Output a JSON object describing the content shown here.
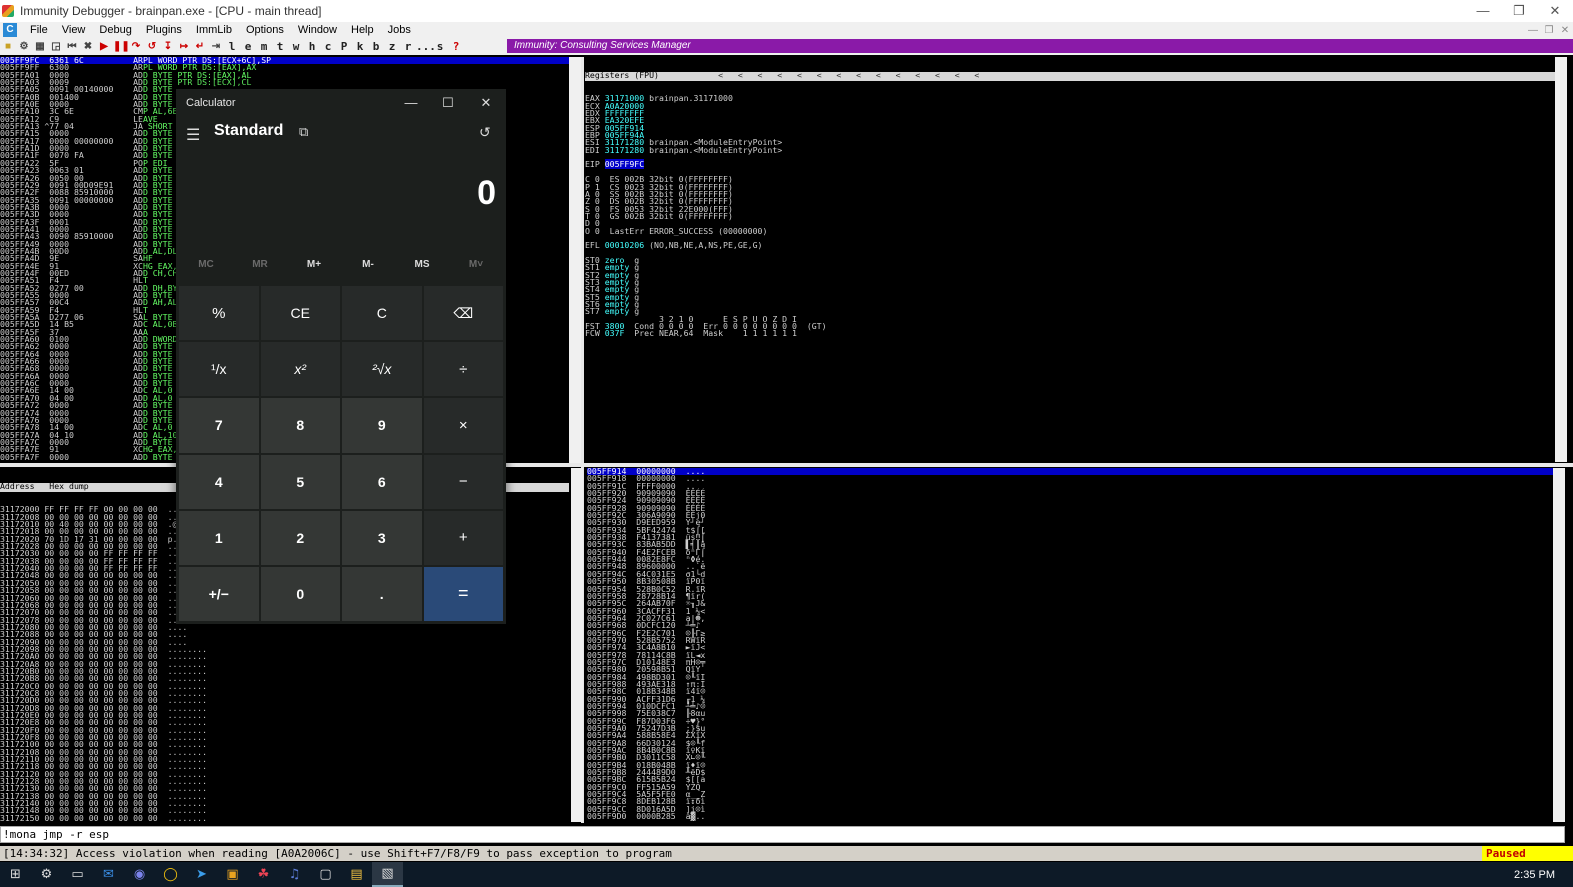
{
  "window": {
    "title": "Immunity Debugger - brainpan.exe - [CPU - main thread]"
  },
  "menu": [
    "File",
    "View",
    "Debug",
    "Plugins",
    "ImmLib",
    "Options",
    "Window",
    "Help",
    "Jobs"
  ],
  "toolbar_letters": [
    "l",
    "e",
    "m",
    "t",
    "w",
    "h",
    "c",
    "P",
    "k",
    "b",
    "z",
    "r",
    "...",
    "s",
    "?"
  ],
  "banner": "Immunity: Consulting Services Manager",
  "cpu_lines": [
    {
      "t": "005FF9FC  6361 6C          ARPL WORD PTR DS:[ECX+6C],SP",
      "sel": true
    },
    {
      "t": "005FF9FF  6300             ARPL WORD PTR DS:[EAX],AX"
    },
    {
      "t": "005FFA01  0000             ADD BYTE PTR DS:[EAX],AL"
    },
    {
      "t": "005FFA03  0009             ADD BYTE PTR DS:[ECX],CL"
    },
    {
      "t": "005FFA05  0091 00140000    ADD BYTE"
    },
    {
      "t": "005FFA0B  001400           ADD BYTE"
    },
    {
      "t": "005FFA0E  0000             ADD BYTE"
    },
    {
      "t": "005FFA10  3C 6E            CMP AL,6E"
    },
    {
      "t": "005FFA12  C9               LEAVE"
    },
    {
      "t": "005FFA13 ^77 04            JA SHORT"
    },
    {
      "t": "005FFA15  0000             ADD BYTE"
    },
    {
      "t": "005FFA17  0000 00000000    ADD BYTE"
    },
    {
      "t": "005FFA1D  0000             ADD BYTE"
    },
    {
      "t": "005FFA1F  0070 FA          ADD BYTE"
    },
    {
      "t": "005FFA22  5F               POP EDI"
    },
    {
      "t": "005FFA23  0063 01          ADD BYTE"
    },
    {
      "t": "005FFA26  0050 00          ADD BYTE"
    },
    {
      "t": "005FFA29  0091 00D09E91    ADD BYTE"
    },
    {
      "t": "005FFA2F  0088 85910000    ADD BYTE"
    },
    {
      "t": "005FFA35  0091 00000000    ADD BYTE"
    },
    {
      "t": "005FFA3B  0000             ADD BYTE"
    },
    {
      "t": "005FFA3D  0000             ADD BYTE"
    },
    {
      "t": "005FFA3F  0001             ADD BYTE"
    },
    {
      "t": "005FFA41  0000             ADD BYTE"
    },
    {
      "t": "005FFA43  0090 85910000    ADD BYTE"
    },
    {
      "t": "005FFA49  0000             ADD BYTE"
    },
    {
      "t": "005FFA4B  00D0             ADD AL,DL"
    },
    {
      "t": "005FFA4D  9E               SAHF"
    },
    {
      "t": "005FFA4E  91               XCHG EAX,ECX"
    },
    {
      "t": "005FFA4F  00ED             ADD CH,CH"
    },
    {
      "t": "005FFA51  F4               HLT"
    },
    {
      "t": "005FFA52  0277 00          ADD DH,BYTE"
    },
    {
      "t": "005FFA55  0000             ADD BYTE"
    },
    {
      "t": "005FFA57  00C4             ADD AH,AL"
    },
    {
      "t": "005FFA59  F4               HLT"
    },
    {
      "t": "005FFA5A  D277 06          SAL BYTE"
    },
    {
      "t": "005FFA5D  14 B5            ADC AL,0B5"
    },
    {
      "t": "005FFA5F  37               AAA"
    },
    {
      "t": "005FFA60  0100             ADD DWORD"
    },
    {
      "t": "005FFA62  0000             ADD BYTE"
    },
    {
      "t": "005FFA64  0000             ADD BYTE"
    },
    {
      "t": "005FFA66  0000             ADD BYTE"
    },
    {
      "t": "005FFA68  0000             ADD BYTE"
    },
    {
      "t": "005FFA6A  0000             ADD BYTE"
    },
    {
      "t": "005FFA6C  0000             ADD BYTE"
    },
    {
      "t": "005FFA6E  14 00            ADC AL,0"
    },
    {
      "t": "005FFA70  04 00            ADD AL,0"
    },
    {
      "t": "005FFA72  0000             ADD BYTE"
    },
    {
      "t": "005FFA74  0000             ADD BYTE"
    },
    {
      "t": "005FFA76  0000             ADD BYTE"
    },
    {
      "t": "005FFA78  14 00            ADC AL,0"
    },
    {
      "t": "005FFA7A  04 10            ADD AL,10"
    },
    {
      "t": "005FFA7C  0000             ADD BYTE"
    },
    {
      "t": "005FFA7E  91               XCHG EAX,"
    },
    {
      "t": "005FFA7F  0000             ADD BYTE"
    }
  ],
  "regs_header": "Registers (FPU)",
  "regs_arrows": "<   <   <   <   <   <   <   <   <   <   <   <   <   <",
  "reg_lines": [
    "EAX 31171000 brainpan.31171000",
    "ECX A0A20000",
    "EDX FFFFFFFF",
    "EBX EA320EFE",
    "ESP 005FF914",
    "EBP 005FF94A",
    "ESI 31171280 brainpan.<ModuleEntryPoint>",
    "EDI 31171280 brainpan.<ModuleEntryPoint>",
    "",
    "EIP 005FF9FC",
    "",
    "C 0  ES 002B 32bit 0(FFFFFFFF)",
    "P 1  CS 0023 32bit 0(FFFFFFFF)",
    "A 0  SS 002B 32bit 0(FFFFFFFF)",
    "Z 0  DS 002B 32bit 0(FFFFFFFF)",
    "S 0  FS 0053 32bit 22E000(FFF)",
    "T 0  GS 002B 32bit 0(FFFFFFFF)",
    "D 0",
    "O 0  LastErr ERROR_SUCCESS (00000000)",
    "",
    "EFL 00010206 (NO,NB,NE,A,NS,PE,GE,G)",
    "",
    "ST0 zero  g",
    "ST1 empty g",
    "ST2 empty g",
    "ST3 empty g",
    "ST4 empty g",
    "ST5 empty g",
    "ST6 empty g",
    "ST7 empty g",
    "               3 2 1 0      E S P U O Z D I",
    "FST 3800  Cond 0 0 0 0  Err 0 0 0 0 0 0 0 0  (GT)",
    "FCW 037F  Prec NEAR,64  Mask    1 1 1 1 1 1"
  ],
  "dump_header": "Address   Hex dump                                         AS",
  "dump_lines": [
    "31172000 FF FF FF FF 00 00 00 00  ....",
    "31172008 00 00 00 00 00 00 00 00  ....",
    "31172010 00 40 00 00 00 00 00 00  .@..",
    "31172018 00 00 00 00 00 00 00 00  ....",
    "31172020 70 1D 17 31 00 00 00 00  p..1",
    "31172028 00 00 00 00 00 00 00 00  ....",
    "31172030 00 00 00 00 FF FF FF FF  ....",
    "31172038 00 00 00 00 FF FF FF FF  ....",
    "31172040 00 00 00 00 FF FF FF FF  ....",
    "31172048 00 00 00 00 00 00 00 00  ....",
    "31172050 00 00 00 00 00 00 00 00  ....",
    "31172058 00 00 00 00 00 00 00 00  ....",
    "31172060 00 00 00 00 00 00 00 00  ....",
    "31172068 00 00 00 00 00 00 00 00  ....",
    "31172070 00 00 00 00 00 00 00 00  ....",
    "31172078 00 00 00 00 00 00 00 00  ....",
    "31172080 00 00 00 00 00 00 00 00  ....",
    "31172088 00 00 00 00 00 00 00 00  ....",
    "31172090 00 00 00 00 00 00 00 00  ....",
    "31172098 00 00 00 00 00 00 00 00  ........",
    "311720A0 00 00 00 00 00 00 00 00  ........",
    "311720A8 00 00 00 00 00 00 00 00  ........",
    "311720B0 00 00 00 00 00 00 00 00  ........",
    "311720B8 00 00 00 00 00 00 00 00  ........",
    "311720C0 00 00 00 00 00 00 00 00  ........",
    "311720C8 00 00 00 00 00 00 00 00  ........",
    "311720D0 00 00 00 00 00 00 00 00  ........",
    "311720D8 00 00 00 00 00 00 00 00  ........",
    "311720E0 00 00 00 00 00 00 00 00  ........",
    "311720E8 00 00 00 00 00 00 00 00  ........",
    "311720F0 00 00 00 00 00 00 00 00  ........",
    "311720F8 00 00 00 00 00 00 00 00  ........",
    "31172100 00 00 00 00 00 00 00 00  ........",
    "31172108 00 00 00 00 00 00 00 00  ........",
    "31172110 00 00 00 00 00 00 00 00  ........",
    "31172118 00 00 00 00 00 00 00 00  ........",
    "31172120 00 00 00 00 00 00 00 00  ........",
    "31172128 00 00 00 00 00 00 00 00  ........",
    "31172130 00 00 00 00 00 00 00 00  ........",
    "31172138 00 00 00 00 00 00 00 00  ........",
    "31172140 00 00 00 00 00 00 00 00  ........",
    "31172148 00 00 00 00 00 00 00 00  ........",
    "31172150 00 00 00 00 00 00 00 00  ........",
    "31172158 00 00 00 00 00 00 00 00  ........",
    "31172160 00 00 00 00 00 00 00 00  ........",
    "31172168 00 00 00 00 00 00 00 00  ........",
    "31172170 00 00 00 00 00 00 00 00  ........"
  ],
  "stack_lines": [
    {
      "t": "005FF914  00000000  ....",
      "sel": true
    },
    {
      "t": "005FF918  00000000  ...."
    },
    {
      "t": "005FF91C  FFFF0000  ..  "
    },
    {
      "t": "005FF920  90909090  ÉÉÉÉ"
    },
    {
      "t": "005FF924  90909090  ÉÉÉÉ"
    },
    {
      "t": "005FF928  90909090  ÉÉÉÉ"
    },
    {
      "t": "005FF92C  306A9090  ÉÉj0"
    },
    {
      "t": "005FF930  D9EED959  Y┘e┘"
    },
    {
      "t": "005FF934  5BF42474  t$⌠["
    },
    {
      "t": "005FF938  F4137381  üs‼⌠"
    },
    {
      "t": "005FF93C  83BAB5DD  ▌╡║â"
    },
    {
      "t": "005FF940  F4E2FCEB  δⁿΓ⌠"
    },
    {
      "t": "005FF944  0082E8FC  ⁿΦé."
    },
    {
      "t": "005FF948  89600000  ..`ë"
    },
    {
      "t": "005FF94C  64C031E5  σ1└d"
    },
    {
      "t": "005FF950  8B30508B  ïP0ï"
    },
    {
      "t": "005FF954  528B0C52  R.ïR"
    },
    {
      "t": "005FF958  28728B14  ¶ïr("
    },
    {
      "t": "005FF95C  264AB70F  ☼╖J&"
    },
    {
      "t": "005FF960  3CACFF31  1 ¼<"
    },
    {
      "t": "005FF964  2C027C61  a|☻,"
    },
    {
      "t": "005FF968  0DCFC120  ┴╧♪"
    },
    {
      "t": "005FF96C  F2E2C701  ☺╟Γ≥"
    },
    {
      "t": "005FF970  528B5752  RWïR"
    },
    {
      "t": "005FF974  3C4A8B10  ►ïJ<"
    },
    {
      "t": "005FF978  78114C8B  ïL◄x"
    },
    {
      "t": "005FF97C  D10148E3  πH☺╤"
    },
    {
      "t": "005FF980  20598B51  QïY "
    },
    {
      "t": "005FF984  498BD301  ☺╙ïI"
    },
    {
      "t": "005FF988  493AE318  ↑π:I"
    },
    {
      "t": "005FF98C  018B348B  ï4ï☺"
    },
    {
      "t": "005FF990  ACFF31D6  ╓1 ¼"
    },
    {
      "t": "005FF994  010DCFC1  ┴╧♪☺"
    },
    {
      "t": "005FF998  75E038C7  ╟8αu"
    },
    {
      "t": "005FF99C  F87D03F6  ÷♥}°"
    },
    {
      "t": "005FF9A0  75247D3B  ;}$u"
    },
    {
      "t": "005FF9A4  588B58E4  ΣXïX"
    },
    {
      "t": "005FF9A8  66D30124  $☺╙f"
    },
    {
      "t": "005FF9AC  8B4B0C8B  ï♀Kï"
    },
    {
      "t": "005FF9B0  D3011C58  X∟☺╙"
    },
    {
      "t": "005FF9B4  018B048B  ï♦ï☺"
    },
    {
      "t": "005FF9B8  244489D0  ╨ëD$"
    },
    {
      "t": "005FF9BC  615B5B24  $[[a"
    },
    {
      "t": "005FF9C0  FF515A59  YZQ "
    },
    {
      "t": "005FF9C4  5A5F5FE0  α__Z"
    },
    {
      "t": "005FF9C8  8DEB128B  ï↕δì"
    },
    {
      "t": "005FF9CC  8D016A5D  ]j☺ì"
    },
    {
      "t": "005FF9D0  0000B285  à▓.."
    }
  ],
  "cpu_sub": "SS:[0011",
  "command": "!mona jmp -r esp",
  "status": {
    "message": "[14:34:32] Access violation when reading [A0A2006C] - use Shift+F7/F8/F9 to pass exception to program",
    "state": "Paused"
  },
  "clock": "2:35 PM",
  "calculator": {
    "title": "Calculator",
    "mode": "Standard",
    "display": "0",
    "memory": [
      "MC",
      "MR",
      "M+",
      "M-",
      "MS",
      "M˅"
    ],
    "keys": [
      "%",
      "CE",
      "C",
      "⌫",
      "¹/x",
      "x²",
      "²√x",
      "÷",
      "7",
      "8",
      "9",
      "×",
      "4",
      "5",
      "6",
      "−",
      "1",
      "2",
      "3",
      "+",
      "+/−",
      "0",
      ".",
      "="
    ]
  },
  "colors": {
    "accent_purple": "#8a1aa8",
    "selection": "#0000c8",
    "paused_bg": "#ffff00",
    "paused_fg": "#c00000",
    "calc_equals": "#2a4a78"
  }
}
